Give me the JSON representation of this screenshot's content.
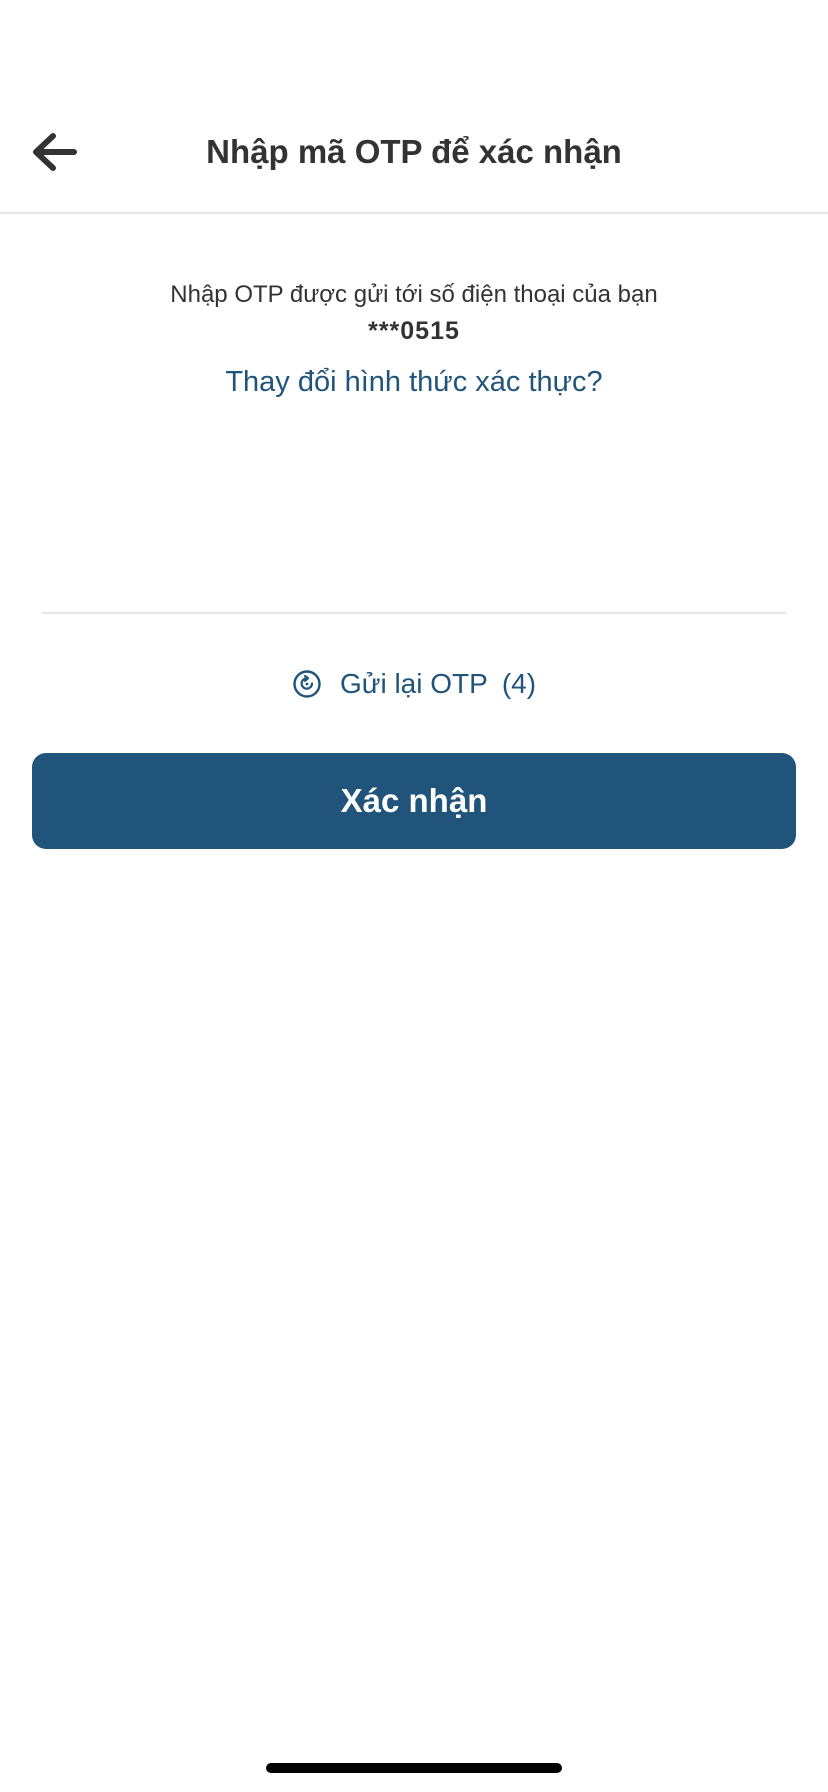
{
  "header": {
    "title": "Nhập mã OTP để xác nhận",
    "back_icon": "arrow-left-icon"
  },
  "main": {
    "instruction": "Nhập OTP được gửi tới số điện thoại của bạn",
    "phone_masked": "***0515",
    "change_method_link": "Thay đổi hình thức xác thực?",
    "otp_value": "",
    "resend": {
      "icon": "timer-icon",
      "label": "Gửi lại OTP",
      "countdown": "(4)"
    },
    "confirm_label": "Xác nhận"
  },
  "colors": {
    "primary": "#21547b",
    "text": "#333333",
    "divider": "#e6e6e6"
  }
}
